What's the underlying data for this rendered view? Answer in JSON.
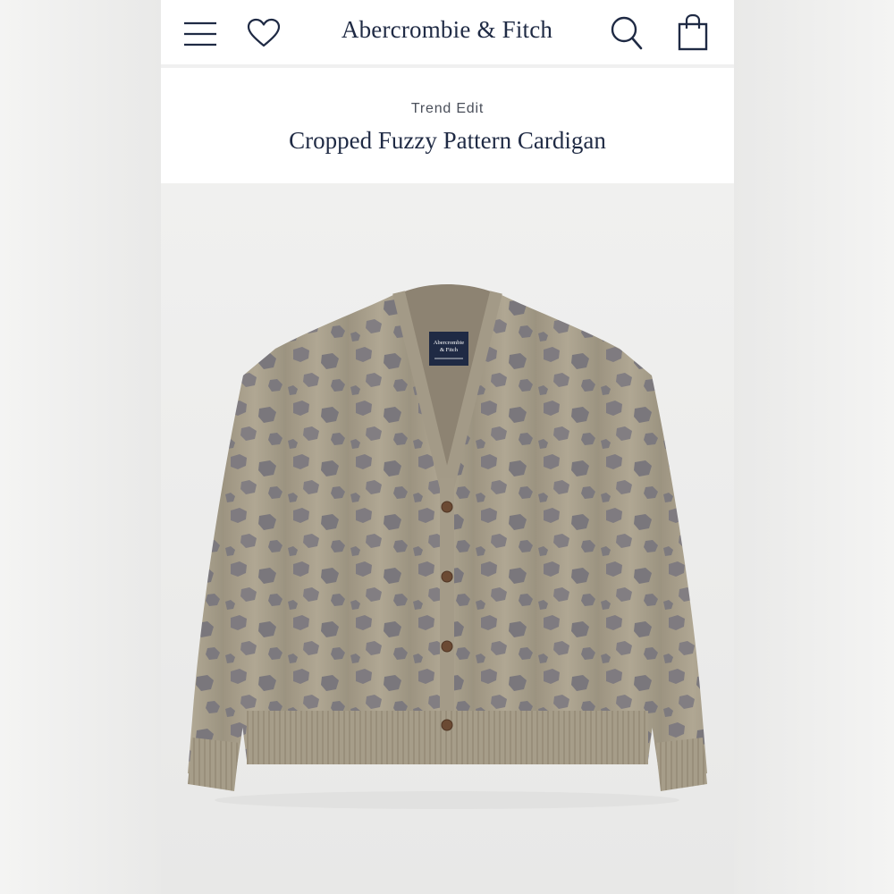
{
  "header": {
    "brand": "Abercrombie & Fitch",
    "icons": [
      "menu-icon",
      "heart-icon",
      "search-icon",
      "bag-icon"
    ]
  },
  "product": {
    "eyebrow": "Trend Edit",
    "title": "Cropped Fuzzy Pattern Cardigan",
    "image": "cropped-fuzzy-pattern-cardigan-photo"
  },
  "label": {
    "brand_top": "Abercrombie",
    "brand_bottom": "& Fitch"
  },
  "colors": {
    "navy": "#1f2a44",
    "knit_base": "#a89f8c",
    "knit_spots": "#7e7b7f",
    "button": "#6b4a33"
  }
}
